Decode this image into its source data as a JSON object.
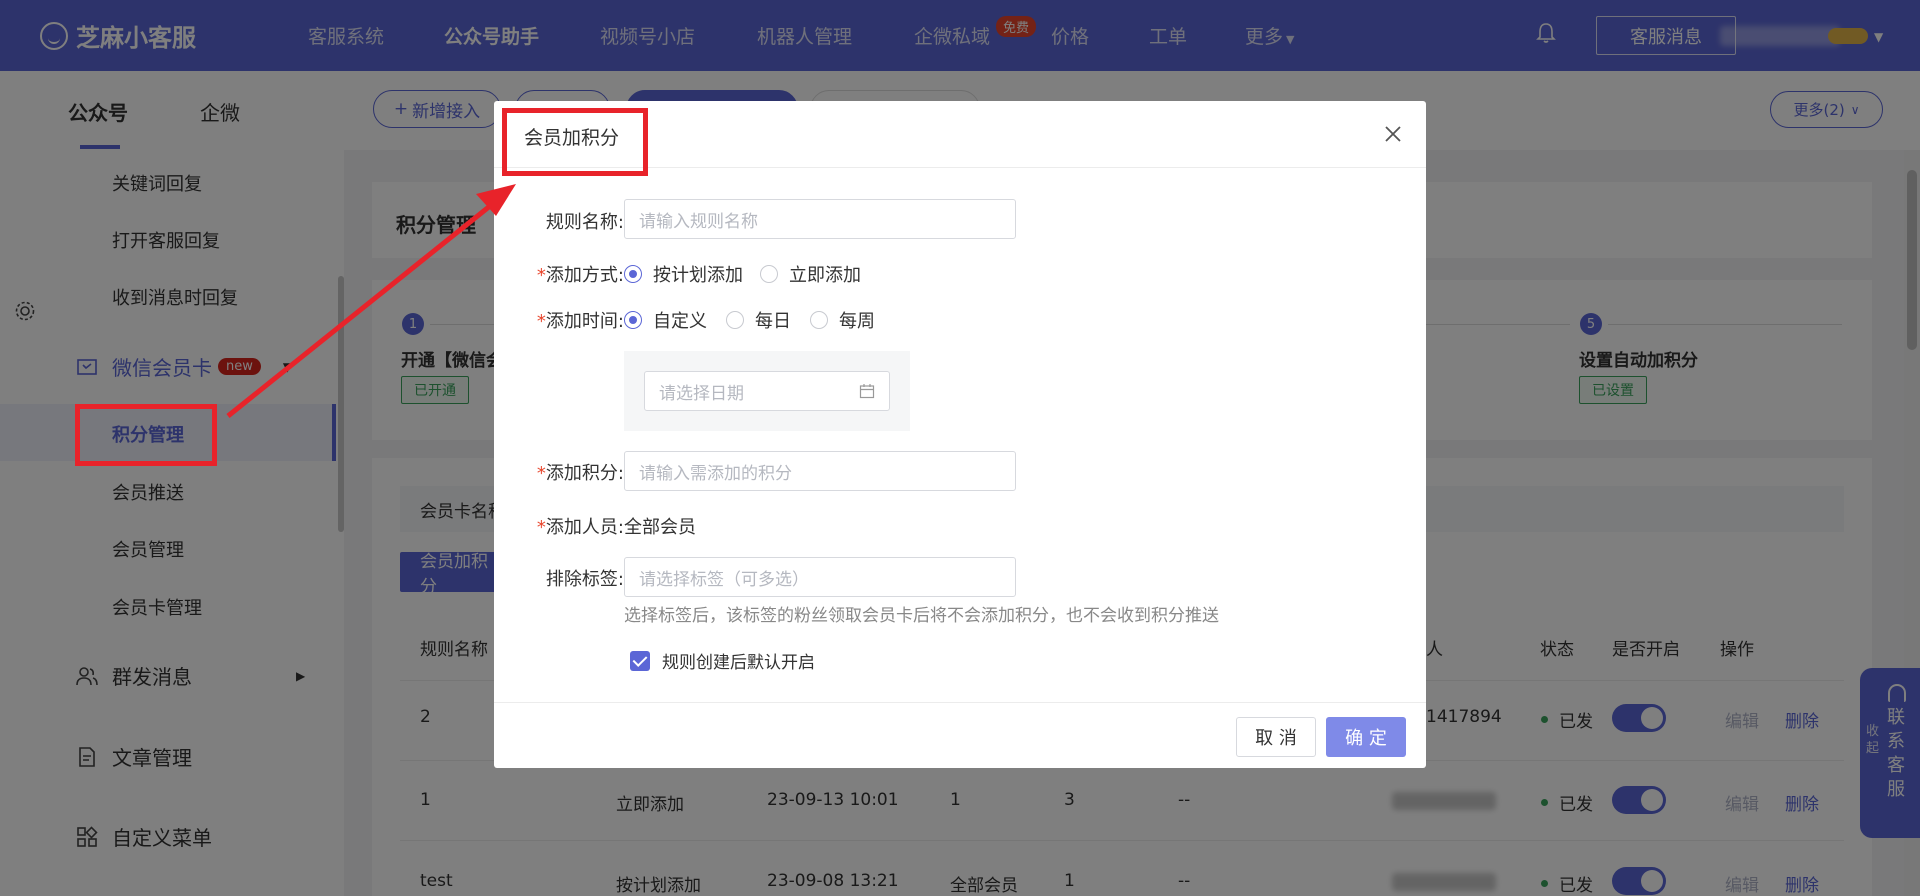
{
  "app": {
    "logo": "芝麻小客服",
    "nav": [
      "客服系统",
      "公众号助手",
      "视频号小店",
      "机器人管理",
      "企微私域",
      "价格",
      "工单",
      "更多"
    ],
    "free_badge": "免费",
    "cs_message_button": "客服消息"
  },
  "subnav": {
    "tabs": [
      "公众号",
      "企微"
    ],
    "new_access_button": "新增接入",
    "more_button": "更多(2)"
  },
  "sidebar": {
    "items_top": [
      "关键词回复",
      "打开客服回复",
      "收到消息时回复"
    ],
    "member_card_group": "微信会员卡",
    "new_badge": "new",
    "member_items": [
      "积分管理",
      "会员推送",
      "会员管理",
      "会员卡管理"
    ],
    "groups": [
      "群发消息",
      "文章管理",
      "自定义菜单"
    ]
  },
  "main": {
    "title": "积分管理",
    "step1_title": "开通【微信会",
    "step1_tag": "已开通",
    "step5_title": "设置自动加积分",
    "step5_tag": "已设置",
    "filter_label": "会员卡名称",
    "add_button": "会员加积分",
    "table_headers": [
      "规则名称",
      "人",
      "状态",
      "是否开启",
      "操作"
    ],
    "rows": [
      {
        "name": "2",
        "mode": "",
        "time": "",
        "people": "",
        "points": "",
        "excl": "",
        "creator": "1417894",
        "status": "已发",
        "edit": "编辑",
        "delete": "删除"
      },
      {
        "name": "1",
        "mode": "立即添加",
        "time": "23-09-13 10:01",
        "people": "1",
        "points": "3",
        "excl": "--",
        "creator": "",
        "status": "已发",
        "edit": "编辑",
        "delete": "删除"
      },
      {
        "name": "test",
        "mode": "按计划添加",
        "time": "23-09-08 13:21",
        "people": "全部会员",
        "points": "1",
        "excl": "--",
        "creator": "",
        "status": "已发",
        "edit": "编辑",
        "delete": "删除"
      }
    ],
    "float_fold": "收起",
    "float_contact": "联系客服"
  },
  "modal": {
    "title": "会员加积分",
    "rule_name_label": "规则名称:",
    "rule_name_placeholder": "请输入规则名称",
    "add_mode_label": "添加方式:",
    "add_mode_options": [
      "按计划添加",
      "立即添加"
    ],
    "add_time_label": "添加时间:",
    "add_time_options": [
      "自定义",
      "每日",
      "每周"
    ],
    "date_placeholder": "请选择日期",
    "points_label": "添加积分:",
    "points_placeholder": "请输入需添加的积分",
    "members_label": "添加人员:",
    "members_value": "全部会员",
    "exclude_label": "排除标签:",
    "exclude_placeholder": "请选择标签（可多选）",
    "exclude_hint": "选择标签后，该标签的粉丝领取会员卡后将不会添加积分，也不会收到积分推送",
    "default_on_label": "规则创建后默认开启",
    "cancel": "取 消",
    "confirm": "确 定"
  }
}
